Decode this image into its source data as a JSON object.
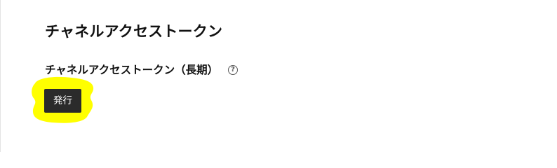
{
  "page": {
    "title": "チャネルアクセストークン"
  },
  "section": {
    "label": "チャネルアクセストークン（長期）",
    "help_icon": "help-circle-icon",
    "help_glyph": "?"
  },
  "actions": {
    "issue_label": "発行"
  },
  "colors": {
    "highlight": "#ffff00",
    "button_bg": "#2b2b2b",
    "button_text": "#ffffff",
    "text": "#111111"
  }
}
